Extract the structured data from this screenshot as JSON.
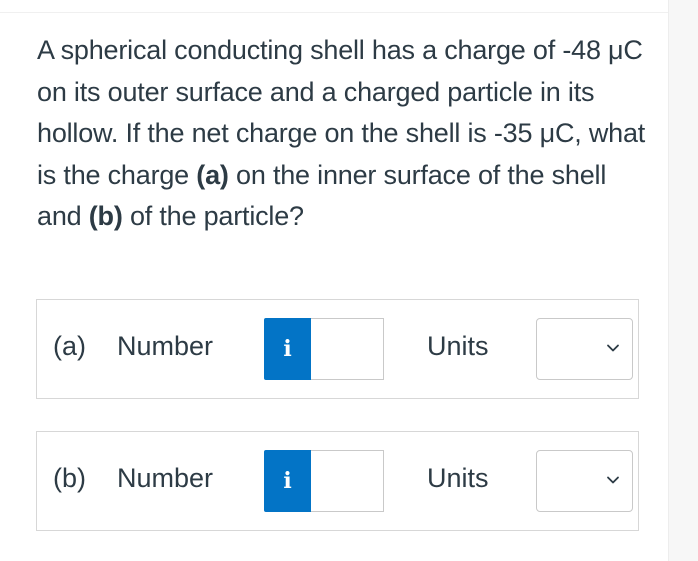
{
  "question": {
    "text_1": "A spherical conducting shell has a charge of -48 μC on its outer surface and a charged particle in its hollow. If the net charge on the shell is -35 μC, what is the charge ",
    "part_a_ref": "(a)",
    "text_2": " on the inner surface of the shell and ",
    "part_b_ref": "(b)",
    "text_3": " of the particle?"
  },
  "answers": [
    {
      "part": "(a)",
      "number_label": "Number",
      "info_icon": "i",
      "number_value": "",
      "units_label": "Units",
      "units_value": ""
    },
    {
      "part": "(b)",
      "number_label": "Number",
      "info_icon": "i",
      "number_value": "",
      "units_label": "Units",
      "units_value": ""
    }
  ],
  "colors": {
    "text": "#2d3b45",
    "info_button": "#0374c6",
    "border": "#d7d7d7"
  },
  "icons": {
    "info": "info-icon",
    "dropdown": "chevron-down-icon"
  }
}
